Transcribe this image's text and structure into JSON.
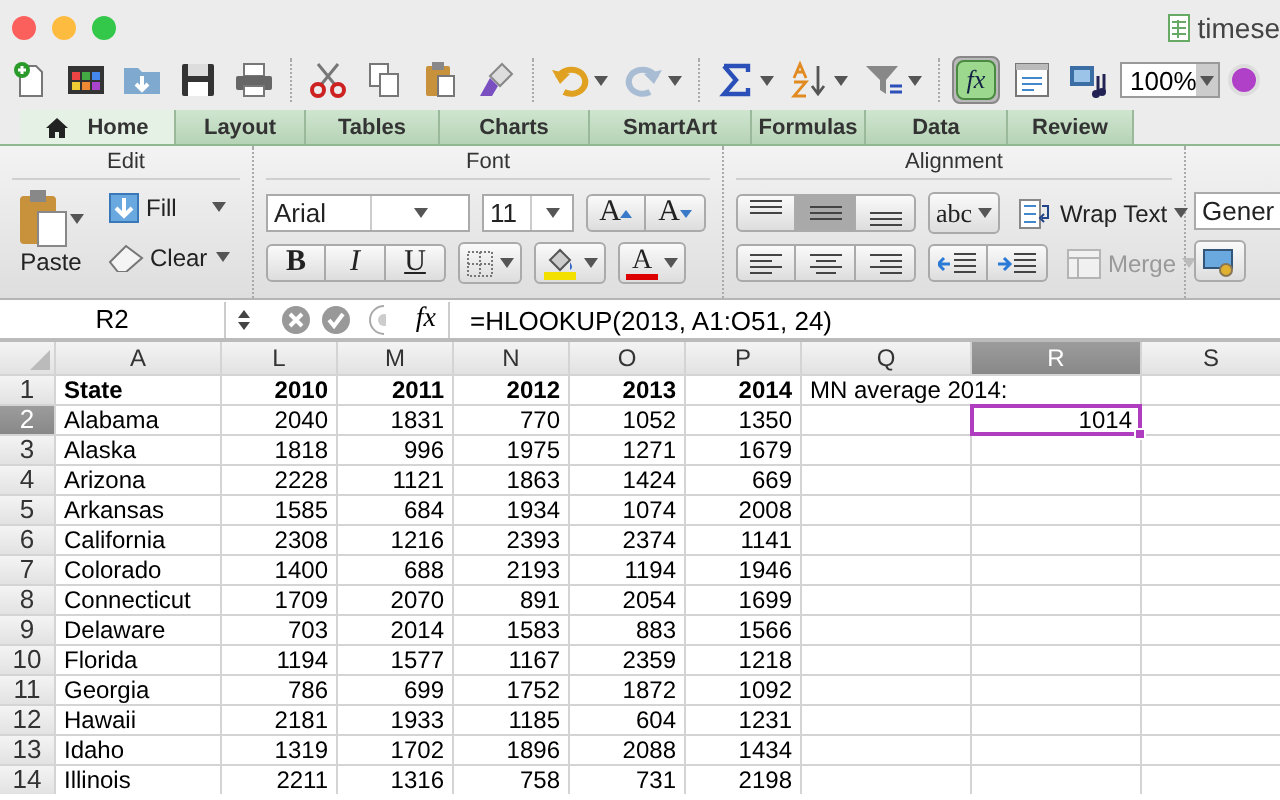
{
  "window": {
    "title": "timese"
  },
  "toolbar": {
    "items": [
      {
        "kind": "new",
        "menu": false,
        "on": false
      },
      {
        "kind": "gallery",
        "menu": false,
        "on": false
      },
      {
        "kind": "open",
        "menu": false,
        "on": false
      },
      {
        "kind": "save",
        "menu": false,
        "on": false
      },
      {
        "kind": "print",
        "menu": false,
        "on": false
      },
      {
        "kind": "cut",
        "menu": false,
        "on": false
      },
      {
        "kind": "copy",
        "menu": false,
        "on": false
      },
      {
        "kind": "paste",
        "menu": false,
        "on": false
      },
      {
        "kind": "brush",
        "menu": false,
        "on": false
      },
      {
        "kind": "undo",
        "menu": true,
        "on": false
      },
      {
        "kind": "redo",
        "menu": true,
        "on": false
      },
      {
        "kind": "sum",
        "menu": true,
        "on": false
      },
      {
        "kind": "sort",
        "menu": true,
        "on": false
      },
      {
        "kind": "filter",
        "menu": true,
        "on": false
      },
      {
        "kind": "fx",
        "label": "fx",
        "menu": false,
        "on": true
      },
      {
        "kind": "toolbox",
        "menu": false,
        "on": false
      },
      {
        "kind": "media",
        "menu": false,
        "on": false
      }
    ],
    "zoom": "100%"
  },
  "tabs": [
    {
      "label": "Home",
      "selected": true
    },
    {
      "label": "Layout",
      "selected": false
    },
    {
      "label": "Tables",
      "selected": false
    },
    {
      "label": "Charts",
      "selected": false
    },
    {
      "label": "SmartArt",
      "selected": false
    },
    {
      "label": "Formulas",
      "selected": false
    },
    {
      "label": "Data",
      "selected": false
    },
    {
      "label": "Review",
      "selected": false
    }
  ],
  "ribbon": {
    "edit": {
      "title": "Edit",
      "paste": "Paste",
      "fill": "Fill",
      "clear": "Clear"
    },
    "font": {
      "title": "Font",
      "name": "Arial",
      "size": "11",
      "grow": "A",
      "shrink": "A",
      "bold": "B",
      "italic": "I",
      "underline": "U",
      "font_color": "A"
    },
    "alignment": {
      "title": "Alignment",
      "vertical": [
        {
          "selected": false
        },
        {
          "selected": true
        },
        {
          "selected": false
        }
      ],
      "horizontal": [
        {
          "selected": false
        },
        {
          "selected": false
        },
        {
          "selected": false
        }
      ],
      "orientation": "abc",
      "wrap_text": "Wrap Text",
      "merge": {
        "label": "Merge",
        "disabled": true
      }
    },
    "number": {
      "format": "Gener"
    }
  },
  "formula_bar": {
    "name_box": "R2",
    "fx_label": "fx",
    "formula": "=HLOOKUP(2013, A1:O51, 24)"
  },
  "sheet": {
    "columns": [
      {
        "label": "A",
        "selected": false
      },
      {
        "label": "L",
        "selected": false
      },
      {
        "label": "M",
        "selected": false
      },
      {
        "label": "N",
        "selected": false
      },
      {
        "label": "O",
        "selected": false
      },
      {
        "label": "P",
        "selected": false
      },
      {
        "label": "Q",
        "selected": false
      },
      {
        "label": "R",
        "selected": true
      },
      {
        "label": "S",
        "selected": false
      }
    ],
    "note": {
      "text": "MN average 2014:"
    },
    "active_cell": {
      "value": "1014"
    },
    "rows": [
      {
        "header": "1",
        "selected": false,
        "cells": [
          "State",
          "2010",
          "2011",
          "2012",
          "2013",
          "2014"
        ]
      },
      {
        "header": "2",
        "selected": true,
        "cells": [
          "Alabama",
          "2040",
          "1831",
          "770",
          "1052",
          "1350"
        ]
      },
      {
        "header": "3",
        "selected": false,
        "cells": [
          "Alaska",
          "1818",
          "996",
          "1975",
          "1271",
          "1679"
        ]
      },
      {
        "header": "4",
        "selected": false,
        "cells": [
          "Arizona",
          "2228",
          "1121",
          "1863",
          "1424",
          "669"
        ]
      },
      {
        "header": "5",
        "selected": false,
        "cells": [
          "Arkansas",
          "1585",
          "684",
          "1934",
          "1074",
          "2008"
        ]
      },
      {
        "header": "6",
        "selected": false,
        "cells": [
          "California",
          "2308",
          "1216",
          "2393",
          "2374",
          "1141"
        ]
      },
      {
        "header": "7",
        "selected": false,
        "cells": [
          "Colorado",
          "1400",
          "688",
          "2193",
          "1194",
          "1946"
        ]
      },
      {
        "header": "8",
        "selected": false,
        "cells": [
          "Connecticut",
          "1709",
          "2070",
          "891",
          "2054",
          "1699"
        ]
      },
      {
        "header": "9",
        "selected": false,
        "cells": [
          "Delaware",
          "703",
          "2014",
          "1583",
          "883",
          "1566"
        ]
      },
      {
        "header": "10",
        "selected": false,
        "cells": [
          "Florida",
          "1194",
          "1577",
          "1167",
          "2359",
          "1218"
        ]
      },
      {
        "header": "11",
        "selected": false,
        "cells": [
          "Georgia",
          "786",
          "699",
          "1752",
          "1872",
          "1092"
        ]
      },
      {
        "header": "12",
        "selected": false,
        "cells": [
          "Hawaii",
          "2181",
          "1933",
          "1185",
          "604",
          "1231"
        ]
      },
      {
        "header": "13",
        "selected": false,
        "cells": [
          "Idaho",
          "1319",
          "1702",
          "1896",
          "2088",
          "1434"
        ]
      },
      {
        "header": "14",
        "selected": false,
        "cells": [
          "Illinois",
          "2211",
          "1316",
          "758",
          "731",
          "2198"
        ]
      }
    ]
  }
}
